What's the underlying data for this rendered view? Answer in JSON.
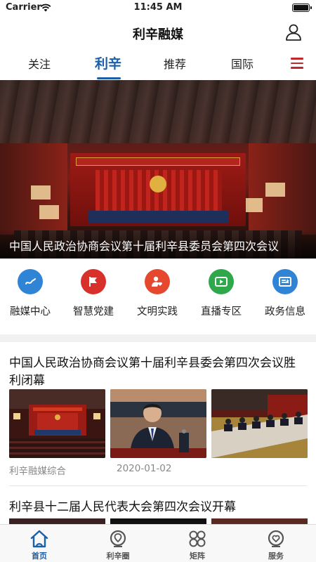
{
  "status_bar": {
    "carrier": "Carrier",
    "time": "11:45 AM"
  },
  "header": {
    "title": "利辛融媒"
  },
  "tabs": [
    {
      "label": "关注",
      "active": false
    },
    {
      "label": "利辛",
      "active": true
    },
    {
      "label": "推荐",
      "active": false
    },
    {
      "label": "国际",
      "active": false
    }
  ],
  "banner": {
    "caption": "中国人民政治协商会议第十届利辛县委员会第四次会议"
  },
  "quick_links": [
    {
      "label": "融媒中心",
      "icon": "link-icon",
      "color": "#2f84d6"
    },
    {
      "label": "智慧党建",
      "icon": "party-flag-icon",
      "color": "#d8302b"
    },
    {
      "label": "文明实践",
      "icon": "heart-person-icon",
      "color": "#e5482f"
    },
    {
      "label": "直播专区",
      "icon": "play-icon",
      "color": "#2ea84a"
    },
    {
      "label": "政务信息",
      "icon": "news-icon",
      "color": "#2f84d6"
    }
  ],
  "articles": [
    {
      "title": "中国人民政治协商会议第十届利辛县委会第四次会议胜利闭幕",
      "source": "利辛融媒综合",
      "date": "2020-01-02"
    },
    {
      "title": "利辛县十二届人民代表大会第四次会议开幕"
    }
  ],
  "tabbar": [
    {
      "label": "首页",
      "icon": "home-icon",
      "active": true
    },
    {
      "label": "利辛圈",
      "icon": "location-icon",
      "active": false
    },
    {
      "label": "矩阵",
      "icon": "grid-icon",
      "active": false
    },
    {
      "label": "服务",
      "icon": "service-icon",
      "active": false
    }
  ],
  "colors": {
    "accent": "#1a5fa8",
    "menu": "#c0282d"
  }
}
